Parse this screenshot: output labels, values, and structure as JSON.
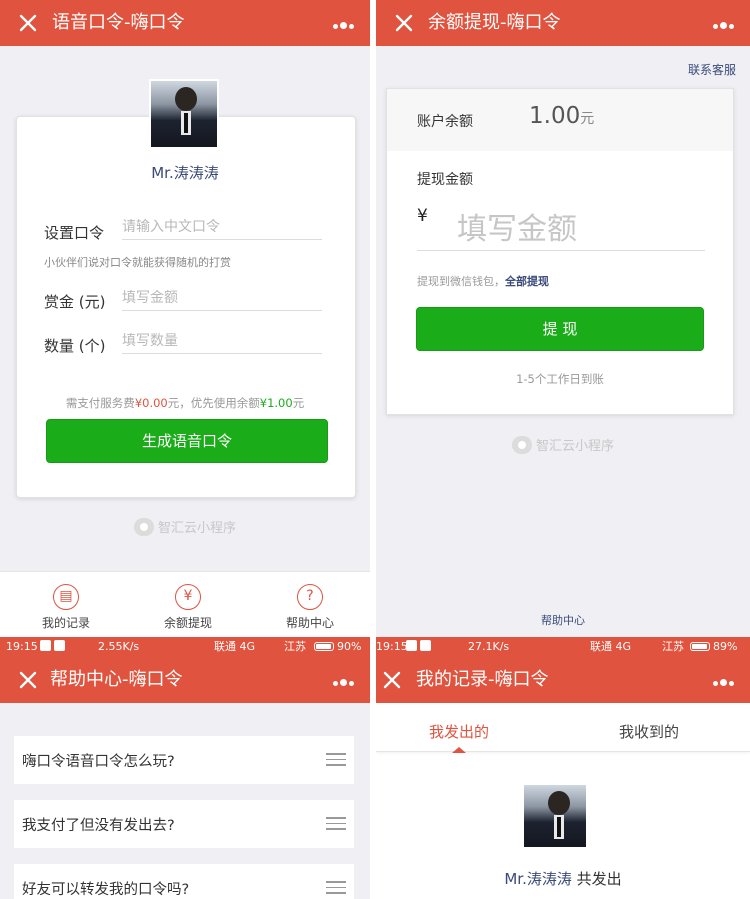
{
  "screens": {
    "voice": {
      "title": "语音口令-嗨口令",
      "user_name": "Mr.涛涛涛",
      "password_label": "设置口令",
      "password_placeholder": "请输入中文口令",
      "password_hint": "小伙伴们说对口令就能获得随机的打赏",
      "reward_label": "赏金 (元)",
      "reward_placeholder": "填写金额",
      "count_label": "数量 (个)",
      "count_placeholder": "填写数量",
      "fee_prefix": "需支付服务费",
      "fee_amount": "¥0.00",
      "fee_middle": "元，优先使用余额",
      "fee_balance": "¥1.00",
      "fee_suffix": "元",
      "generate_button": "生成语音口令",
      "brand": "智汇云小程序",
      "tabs": [
        {
          "icon": "record-icon",
          "glyph": "▤",
          "label": "我的记录"
        },
        {
          "icon": "yen-icon",
          "glyph": "¥",
          "label": "余额提现"
        },
        {
          "icon": "help-icon",
          "glyph": "?",
          "label": "帮助中心"
        }
      ]
    },
    "withdraw": {
      "title": "余额提现-嗨口令",
      "contact": "联系客服",
      "balance_label": "账户余额",
      "balance_value": "1.00",
      "balance_unit": "元",
      "amount_label": "提现金额",
      "currency": "¥",
      "amount_placeholder": "填写金额",
      "wallet_text": "提现到微信钱包，",
      "withdraw_all": "全部提现",
      "button": "提 现",
      "arrival": "1-5个工作日到账",
      "brand": "智汇云小程序",
      "help_center": "帮助中心"
    },
    "help": {
      "status": {
        "time": "19:15",
        "speed": "2.55K/s",
        "carrier": "联通 4G",
        "region": "江苏",
        "battery": "90%"
      },
      "title": "帮助中心-嗨口令",
      "faqs": [
        "嗨口令语音口令怎么玩?",
        "我支付了但没有发出去?",
        "好友可以转发我的口令吗?"
      ]
    },
    "records": {
      "status": {
        "time": "19:15",
        "speed": "27.1K/s",
        "carrier": "联通 4G",
        "region": "江苏",
        "battery": "89%"
      },
      "title": "我的记录-嗨口令",
      "tab_sent": "我发出的",
      "tab_received": "我收到的",
      "user_name": "Mr.涛涛涛",
      "sent_text": " 共发出"
    }
  },
  "colors": {
    "accent": "#e0533f",
    "green": "#1aad19",
    "link": "#3a4a7a"
  }
}
